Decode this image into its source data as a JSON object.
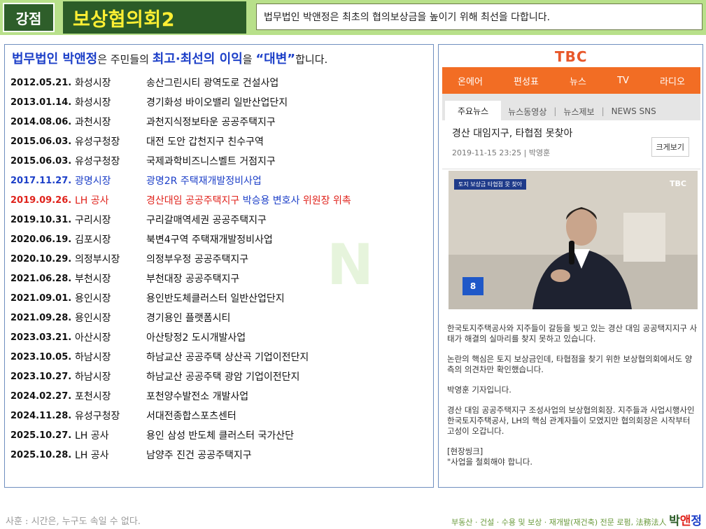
{
  "header": {
    "tag": "강점",
    "title": "보상협의회2",
    "subtitle": "법무법인 박앤정은 최초의 협의보상금을 높이기 위해 최선을 다합니다."
  },
  "intro": {
    "firm": "법무법인 박앤정",
    "t1": "은 주민들의 ",
    "best": "최고·최선의 이익",
    "t2": "을 ",
    "advocacy": "“대변”",
    "t3": "합니다."
  },
  "watermark": "N",
  "cases": [
    {
      "date": "2012.05.21.",
      "org": "화성시장",
      "project": "송산그린시티 광역도로 건설사업"
    },
    {
      "date": "2013.01.14.",
      "org": "화성시장",
      "project": "경기화성 바이오밸리 일반산업단지"
    },
    {
      "date": "2014.08.06.",
      "org": "과천시장",
      "project": "과천지식정보타운 공공주택지구"
    },
    {
      "date": "2015.06.03.",
      "org": "유성구청장",
      "project": "대전 도안 갑천지구 친수구역"
    },
    {
      "date": "2015.06.03.",
      "org": "유성구청장",
      "project": "국제과학비즈니스벨트 거점지구"
    },
    {
      "date": "2017.11.27.",
      "org": "광명시장",
      "project": "광명2R 주택재개발정비사업"
    },
    {
      "date": "2019.09.26.",
      "org": "LH 공사",
      "project_a": "경산대임 공공주택지구",
      "project_b": "박승용 변호사",
      "project_c": "위원장 위촉"
    },
    {
      "date": "2019.10.31.",
      "org": "구리시장",
      "project": "구리갈매역세권 공공주택지구"
    },
    {
      "date": "2020.06.19.",
      "org": "김포시장",
      "project": "북변4구역 주택재개발정비사업"
    },
    {
      "date": "2020.10.29.",
      "org": "의정부시장",
      "project": "의정부우정 공공주택지구"
    },
    {
      "date": "2021.06.28.",
      "org": "부천시장",
      "project": "부천대장 공공주택지구"
    },
    {
      "date": "2021.09.01.",
      "org": "용인시장",
      "project": "용인반도체클러스터 일반산업단지"
    },
    {
      "date": "2021.09.28.",
      "org": "용인시장",
      "project": "경기용인 플랫폼시티"
    },
    {
      "date": "2023.03.21.",
      "org": "아산시장",
      "project": "아산탕정2 도시개발사업"
    },
    {
      "date": "2023.10.05.",
      "org": "하남시장",
      "project": "하남교산 공공주택 상산곡 기업이전단지"
    },
    {
      "date": "2023.10.27.",
      "org": "하남시장",
      "project": "하남교산 공공주택 광암 기업이전단지"
    },
    {
      "date": "2024.02.27.",
      "org": "포천시장",
      "project": "포천양수발전소 개발사업"
    },
    {
      "date": "2024.11.28.",
      "org": "유성구청장",
      "project": "서대전종합스포츠센터"
    },
    {
      "date": "2025.10.27.",
      "org": "LH 공사",
      "project": "용인 삼성 반도체 클러스터 국가산단"
    },
    {
      "date": "2025.10.28.",
      "org": "LH 공사",
      "project": "남양주 진건 공공주택지구"
    }
  ],
  "news": {
    "logo": "TBC",
    "nav": [
      "온에어",
      "편성표",
      "뉴스",
      "TV",
      "라디오"
    ],
    "subnav": [
      "주요뉴스",
      "뉴스동영상",
      "뉴스제보",
      "NEWS SNS"
    ],
    "title": "경산 대임지구, 타협점 못찾아",
    "meta": "2019-11-15 23:25 | 박영훈",
    "zoom_label": "크게보기",
    "photo_tag": "토지 보상금 타협점 못 찾아",
    "photo_logo": "TBC",
    "photo_badge": "8",
    "paragraphs": [
      "한국토지주택공사와 지주들이 갈등을 빚고 있는 경산 대임 공공택지지구 사태가 해결의 실마리를 찾지 못하고 있습니다.",
      "논란의 핵심은 토지 보상금인데, 타협점을 찾기 위한 보상협의회에서도 양측의 의견차만 확인했습니다.",
      "박영훈 기자입니다.",
      "경산 대임 공공주택지구 조성사업의 보상협의회장. 지주들과 사업시행사인 한국토지주택공사, LH의 핵심 관계자들이 모였지만 협의회장은 시작부터 고성이 오갑니다.",
      "[현장씽크]\n\"사업을 철회해야 합니다."
    ]
  },
  "footer": {
    "motto": "사훈 : 시간은, 누구도 속일 수 없다.",
    "specialty": "부동산 · 건설 · 수용 및 보상 · 재개발(재건축) 전문 로펌, 法務法人",
    "name_1": "박",
    "name_2": "앤",
    "name_3": "정"
  },
  "colors": {
    "header_bg": "#b8e08a",
    "title_bg": "#2b5c27",
    "title_text": "#ffef33",
    "accent_blue": "#1c3fc8",
    "accent_red": "#e0231c",
    "tbc_orange": "#f26d24"
  }
}
